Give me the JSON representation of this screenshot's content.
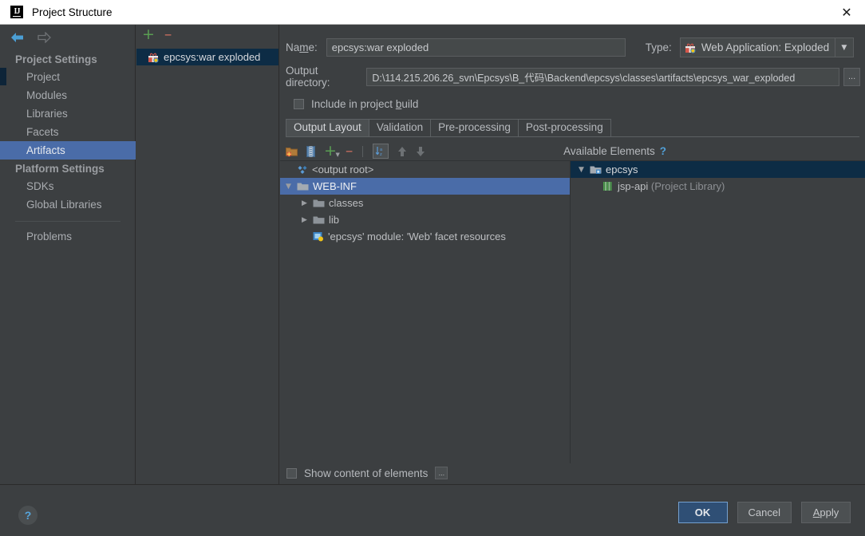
{
  "window": {
    "title": "Project Structure",
    "logo_text": "IJ",
    "close_icon": "✕"
  },
  "sidebar": {
    "back_icon": "arrow-left-icon",
    "forward_icon": "arrow-right-icon",
    "groups": [
      {
        "label": "Project Settings",
        "items": [
          "Project",
          "Modules",
          "Libraries",
          "Facets",
          "Artifacts"
        ],
        "selected": "Artifacts"
      },
      {
        "label": "Platform Settings",
        "items": [
          "SDKs",
          "Global Libraries"
        ]
      }
    ],
    "problems": "Problems"
  },
  "artifacts_panel": {
    "add_label": "+",
    "remove_label": "–",
    "items": [
      {
        "label": "epcsys:war exploded",
        "selected": true
      }
    ]
  },
  "details": {
    "name_label": "Na",
    "name_label_u": "m",
    "name_label_rest": "e:",
    "name_value": "epcsys:war exploded",
    "type_label": "Type:",
    "type_value": "Web Application: Exploded",
    "combo_arrow": "▼",
    "output_label": "Output directory:",
    "output_value": "D:\\114.215.206.26_svn\\Epcsys\\B_代码\\Backend\\epcsys\\classes\\artifacts\\epcsys_war_exploded",
    "browse_label": "...",
    "include_checkbox": {
      "label_pre": "Include in project ",
      "label_u": "b",
      "label_post": "uild",
      "checked": false
    },
    "tabs": [
      {
        "label": "Output Layout",
        "active": true
      },
      {
        "label": "Validation",
        "active": false
      },
      {
        "label": "Pre-processing",
        "active": false
      },
      {
        "label": "Post-processing",
        "active": false
      }
    ],
    "toolbar": {
      "create_dir_icon": "folder-add-icon",
      "create_archive_icon": "archive-icon",
      "add_icon": "+",
      "remove_icon": "–",
      "sort_icon": "sort-alpha-icon",
      "up_icon": "arrow-up-icon",
      "down_icon": "arrow-down-icon"
    },
    "available_elements_label": "Available Elements",
    "help_icon": "?",
    "output_tree": [
      {
        "label": "<output root>",
        "icon": "output-root-icon",
        "indent": 0,
        "expander": "",
        "selected": false
      },
      {
        "label": "WEB-INF",
        "icon": "folder-icon",
        "indent": 0,
        "expander": "▼",
        "selected": true
      },
      {
        "label": "classes",
        "icon": "folder-icon",
        "indent": 1,
        "expander": "▶",
        "selected": false
      },
      {
        "label": "lib",
        "icon": "folder-icon",
        "indent": 1,
        "expander": "▶",
        "selected": false
      },
      {
        "label": "'epcsys' module: 'Web' facet resources",
        "icon": "facet-icon",
        "indent": 1,
        "expander": "",
        "selected": false
      }
    ],
    "available_tree": [
      {
        "label": "epcsys",
        "suffix": "",
        "icon": "module-icon",
        "indent": 0,
        "expander": "▼",
        "selected": true
      },
      {
        "label": "jsp-api",
        "suffix": " (Project Library)",
        "icon": "library-icon",
        "indent": 1,
        "expander": "",
        "selected": false
      }
    ],
    "show_content": {
      "label": "Show content of elements",
      "checked": false,
      "more_label": "..."
    }
  },
  "footer": {
    "help_label": "?",
    "ok_label": "OK",
    "cancel_label": "Cancel",
    "apply_label_u": "A",
    "apply_label_rest": "pply"
  },
  "colors": {
    "accent_selection": "#4a6ca8",
    "unfocused_selection": "#0d2c45",
    "background": "#3c3f41",
    "link_blue": "#51a0d8"
  }
}
